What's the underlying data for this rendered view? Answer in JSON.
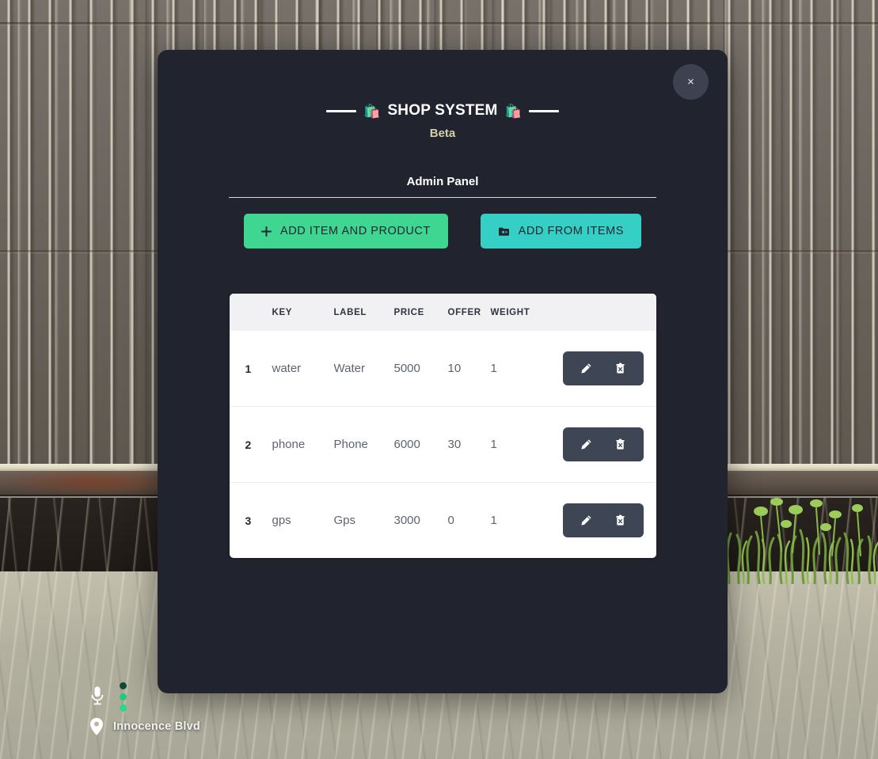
{
  "background": {
    "scene_name": "fence-and-ground-backdrop"
  },
  "modal": {
    "close_label": "×",
    "brand": {
      "emoji_left": "🛍️",
      "emoji_right": "🛍️",
      "title": "SHOP SYSTEM",
      "subtitle": "Beta"
    },
    "panel": {
      "title": "Admin Panel"
    },
    "actions": {
      "add_item_and_product": {
        "label": "ADD ITEM AND PRODUCT",
        "icon": "plus-icon",
        "color": "#3ed690"
      },
      "add_from_items": {
        "label": "ADD FROM ITEMS",
        "icon": "folder-icon",
        "color": "#35cfc5"
      }
    },
    "table": {
      "columns": [
        "",
        "KEY",
        "LABEL",
        "PRICE",
        "OFFER",
        "WEIGHT",
        ""
      ],
      "rows": [
        {
          "index": "1",
          "key": "water",
          "label": "Water",
          "price": "5000",
          "offer": "10",
          "weight": "1",
          "edit_icon": "pencil-icon",
          "delete_icon": "trash-icon"
        },
        {
          "index": "2",
          "key": "phone",
          "label": "Phone",
          "price": "6000",
          "offer": "30",
          "weight": "1",
          "edit_icon": "pencil-icon",
          "delete_icon": "trash-icon"
        },
        {
          "index": "3",
          "key": "gps",
          "label": "Gps",
          "price": "3000",
          "offer": "0",
          "weight": "1",
          "edit_icon": "pencil-icon",
          "delete_icon": "trash-icon"
        }
      ]
    }
  },
  "hud": {
    "microphone_icon": "microphone-icon",
    "voice_range_dots": [
      "#0d4a33",
      "#21c97f",
      "#27d98b"
    ],
    "location_icon": "location-pin-icon",
    "street_name": "Innocence Blvd"
  },
  "colors": {
    "modal_background": "#21232e",
    "accent_green": "#3ed690",
    "accent_teal": "#35cfc5",
    "action_button": "#3e4555",
    "subtitle": "#d6cfa8"
  }
}
